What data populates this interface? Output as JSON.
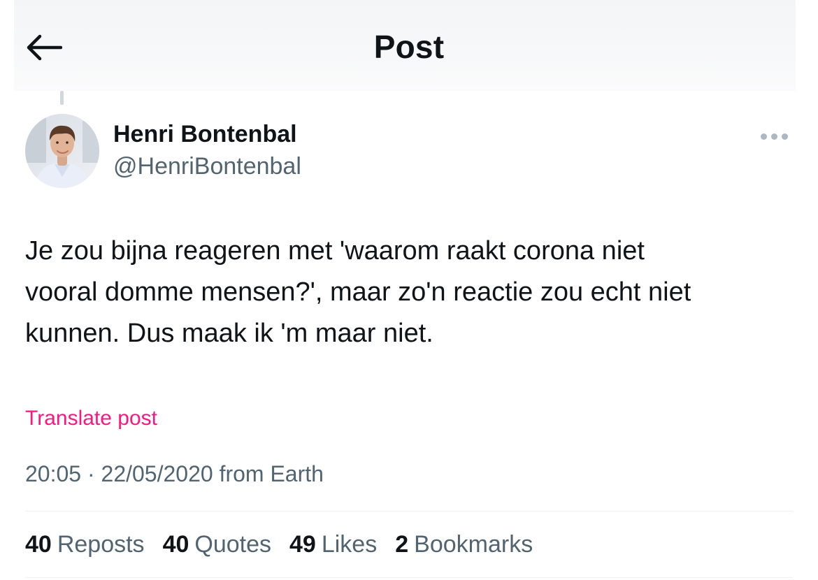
{
  "header": {
    "title": "Post",
    "back_icon": "arrow-left-icon"
  },
  "author": {
    "display_name": "Henri Bontenbal",
    "handle": "@HenriBontenbal",
    "avatar_icon": "profile-photo"
  },
  "post": {
    "text": "Je zou bijna reageren met 'waarom raakt corona niet\nvooral domme mensen?', maar zo'n reactie zou echt niet\nkunnen. Dus maak ik 'm maar niet.",
    "translate_label": "Translate post",
    "time": "20:05",
    "separator": "·",
    "date": "22/05/2020",
    "source": "from Earth"
  },
  "stats": [
    {
      "count": "40",
      "label": "Reposts"
    },
    {
      "count": "40",
      "label": "Quotes"
    },
    {
      "count": "49",
      "label": "Likes"
    },
    {
      "count": "2",
      "label": "Bookmarks"
    }
  ],
  "colors": {
    "text": "#0f1419",
    "secondary": "#536471",
    "translate": "#f91880",
    "divider": "#eff3f4"
  }
}
